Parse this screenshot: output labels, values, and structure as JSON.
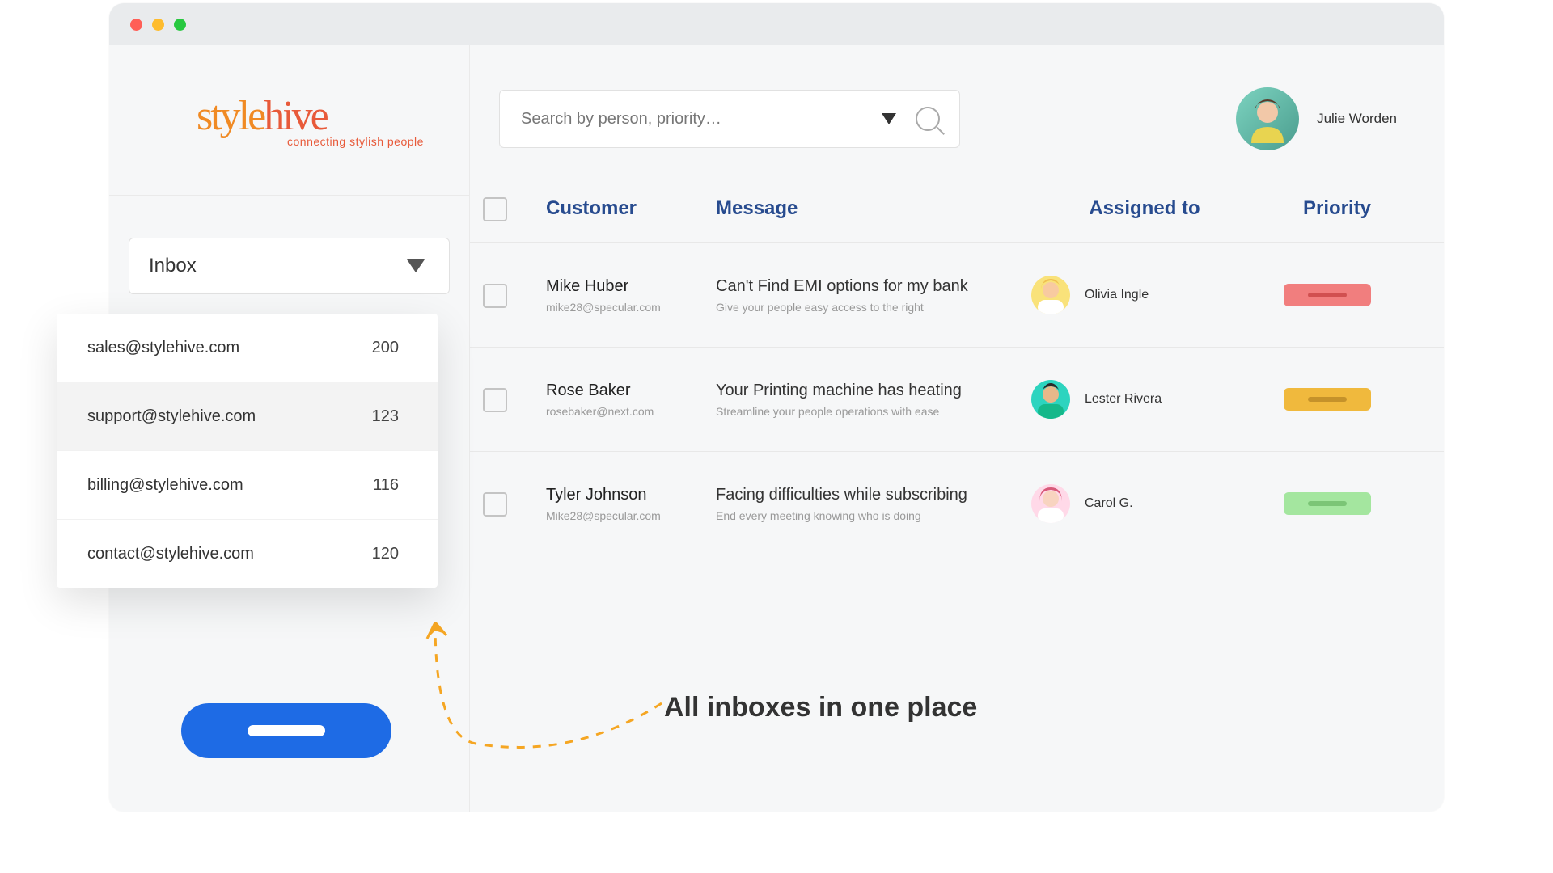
{
  "brand": {
    "name_part_a": "style",
    "name_part_b": "hive",
    "tagline": "connecting stylish people"
  },
  "search": {
    "placeholder": "Search by person, priority…"
  },
  "current_user": {
    "name": "Julie Worden"
  },
  "sidebar": {
    "inbox_label": "Inbox"
  },
  "inbox_options": [
    {
      "email": "sales@stylehive.com",
      "count": "200"
    },
    {
      "email": "support@stylehive.com",
      "count": "123"
    },
    {
      "email": "billing@stylehive.com",
      "count": "116"
    },
    {
      "email": "contact@stylehive.com",
      "count": "120"
    }
  ],
  "columns": {
    "customer": "Customer",
    "message": "Message",
    "assigned": "Assigned to",
    "priority": "Priority"
  },
  "rows": [
    {
      "name": "Mike Huber",
      "email": "mike28@specular.com",
      "subject": "Can't Find EMI options for my bank",
      "preview": "Give your people easy access to the right",
      "assignee": "Olivia Ingle",
      "priority": "red"
    },
    {
      "name": "Rose Baker",
      "email": "rosebaker@next.com",
      "subject": "Your Printing machine has heating",
      "preview": "Streamline your people operations with ease",
      "assignee": "Lester Rivera",
      "priority": "orange"
    },
    {
      "name": "Tyler Johnson",
      "email": "Mike28@specular.com",
      "subject": "Facing difficulties while subscribing",
      "preview": "End every meeting knowing who is doing",
      "assignee": "Carol G.",
      "priority": "green"
    }
  ],
  "caption": "All inboxes in one place",
  "avatars": {
    "olivia": {
      "bg": "#f9e27a",
      "hair": "#f0c050",
      "skin": "#f8caa0"
    },
    "lester": {
      "bg": "#2dd4bf",
      "hair": "#2a2a2a",
      "skin": "#e8b88a"
    },
    "carol": {
      "bg": "#ffd9e8",
      "hair": "#d85a7a",
      "skin": "#f8d4c0"
    },
    "julie": {
      "hair": "#5a3a2a",
      "skin": "#f2c8a8",
      "shirt": "#e8d450"
    }
  }
}
